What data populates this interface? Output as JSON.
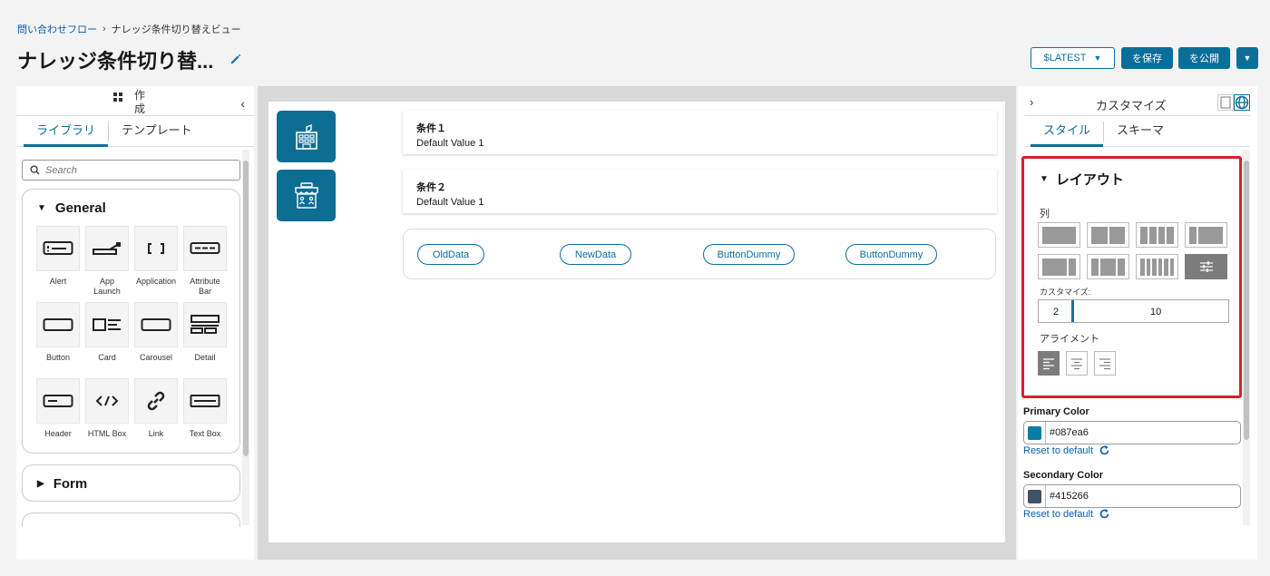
{
  "breadcrumb": {
    "parent": "問い合わせフロー",
    "separator": "›",
    "current": "ナレッジ条件切り替えビュー"
  },
  "page": {
    "title": "ナレッジ条件切り替..."
  },
  "header_actions": {
    "version": "$LATEST",
    "save": "を保存",
    "publish": "を公開"
  },
  "left_panel": {
    "title": "作成",
    "tabs": [
      "ライブラリ",
      "テンプレート"
    ],
    "active_tab": 0,
    "search_placeholder": "Search",
    "sections": [
      {
        "name": "General",
        "expanded": true,
        "components": [
          {
            "label": "Alert",
            "icon": "alert-icon"
          },
          {
            "label": "App Launch",
            "icon": "app-launch-icon"
          },
          {
            "label": "Application",
            "icon": "application-icon"
          },
          {
            "label": "Attribute Bar",
            "icon": "attribute-bar-icon"
          },
          {
            "label": "Button",
            "icon": "button-icon"
          },
          {
            "label": "Card",
            "icon": "card-icon"
          },
          {
            "label": "Carousel",
            "icon": "carousel-icon"
          },
          {
            "label": "Detail",
            "icon": "detail-icon"
          },
          {
            "label": "Header",
            "icon": "header-icon"
          },
          {
            "label": "HTML Box",
            "icon": "html-box-icon"
          },
          {
            "label": "Link",
            "icon": "link-icon"
          },
          {
            "label": "Text Box",
            "icon": "text-box-icon"
          }
        ]
      },
      {
        "name": "Form",
        "expanded": false
      }
    ]
  },
  "canvas": {
    "nav_tiles": [
      {
        "icon": "building-icon"
      },
      {
        "icon": "storefront-icon"
      }
    ],
    "conditions": [
      {
        "title": "条件１",
        "value": "Default Value 1"
      },
      {
        "title": "条件２",
        "value": "Default Value 1"
      }
    ],
    "buttons": [
      "OldData",
      "NewData",
      "ButtonDummy",
      "ButtonDummy"
    ]
  },
  "right_panel": {
    "title": "カスタマイズ",
    "tabs": [
      "スタイル",
      "スキーマ"
    ],
    "active_tab": 0,
    "layout": {
      "title": "レイアウト",
      "columns_label": "列",
      "customize_label": "カスタマイズ:",
      "range_start": "2",
      "range_end": "10",
      "alignment_label": "アライメント"
    },
    "primary_color": {
      "label": "Primary Color",
      "value": "#087ea6",
      "reset": "Reset to default"
    },
    "secondary_color": {
      "label": "Secondary Color",
      "value": "#415266",
      "reset": "Reset to default"
    }
  },
  "colors": {
    "accent": "#0b6e99",
    "link": "#0b5cab",
    "highlight_border": "#dc1e2b"
  }
}
